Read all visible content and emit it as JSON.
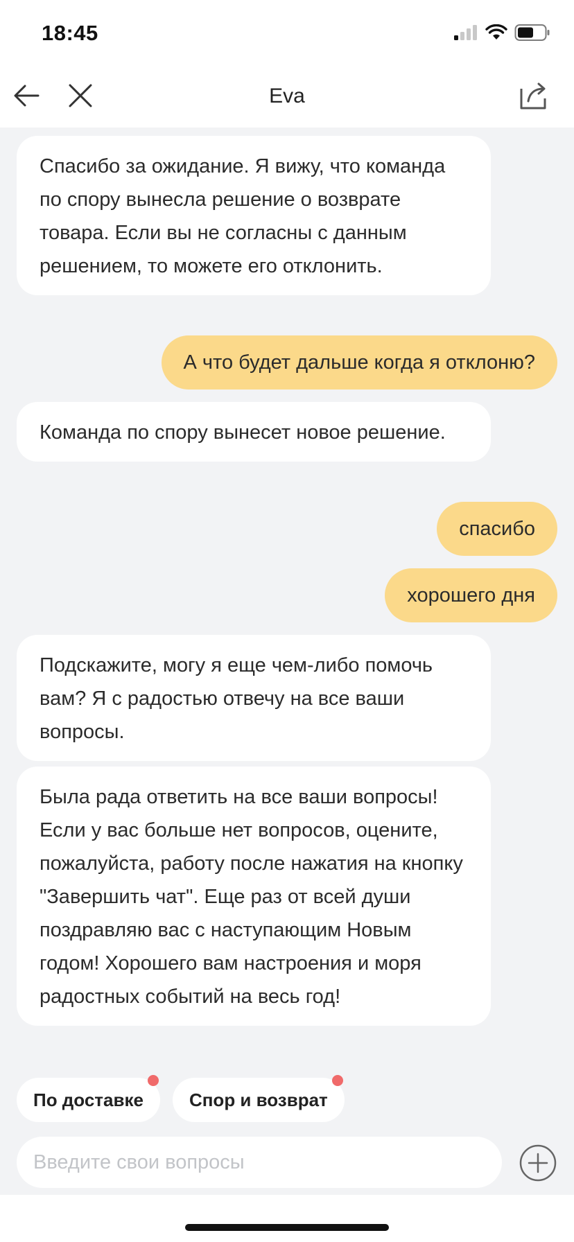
{
  "status": {
    "time": "18:45"
  },
  "header": {
    "title": "Eva"
  },
  "messages": [
    {
      "from": "bot",
      "text": "Спасибо за ожидание. Я вижу, что команда по спору вынесла решение о возврате товара. Если вы не согласны с данным решением, то можете его отклонить."
    },
    {
      "from": "user",
      "text": "А что будет дальше когда я отклоню?"
    },
    {
      "from": "bot",
      "text": "Команда по спору вынесет новое решение."
    },
    {
      "from": "user",
      "text": "спасибо"
    },
    {
      "from": "user",
      "text": "хорошего дня"
    },
    {
      "from": "bot",
      "text": "Подскажите, могу я еще чем-либо помочь вам? Я с радостью отвечу на все ваши вопросы."
    },
    {
      "from": "bot",
      "text": "Была рада ответить на все ваши вопросы! Если у вас больше нет вопросов, оцените, пожалуйста, работу после нажатия на кнопку \"Завершить чат\". Еще раз от всей души поздравляю вас с наступающим Новым годом! Хорошего вам настроения и моря радостных событий на весь год!"
    }
  ],
  "chips": [
    {
      "label": "По доставке"
    },
    {
      "label": "Спор и возврат"
    }
  ],
  "composer": {
    "placeholder": "Введите свои вопросы"
  },
  "colors": {
    "user_bubble": "#fbd98a",
    "bot_bubble": "#ffffff",
    "background": "#f2f3f5",
    "badge_dot": "#f06a6a"
  }
}
